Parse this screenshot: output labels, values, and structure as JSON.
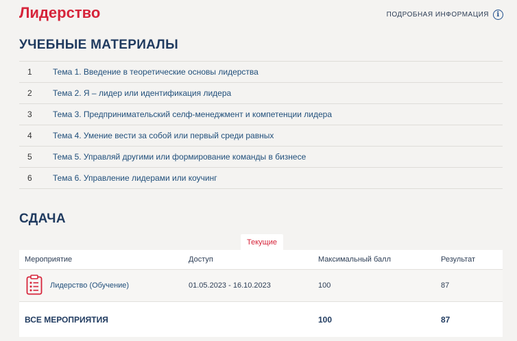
{
  "header": {
    "title": "Лидерство",
    "more_info_label": "ПОДРОБНАЯ ИНФОРМАЦИЯ"
  },
  "materials": {
    "title": "УЧЕБНЫЕ МАТЕРИАЛЫ",
    "items": [
      {
        "num": "1",
        "label": "Тема 1. Введение в теоретические основы лидерства"
      },
      {
        "num": "2",
        "label": "Тема 2. Я – лидер или идентификация лидера"
      },
      {
        "num": "3",
        "label": "Тема 3. Предпринимательский селф-менеджмент и компетенции лидера"
      },
      {
        "num": "4",
        "label": "Тема 4. Умение вести за собой или первый среди равных"
      },
      {
        "num": "5",
        "label": "Тема 5. Управляй другими или формирование команды в бизнесе"
      },
      {
        "num": "6",
        "label": "Тема 6. Управление лидерами или коучинг"
      }
    ]
  },
  "submission": {
    "title": "СДАЧА",
    "tab_label": "Текущие",
    "columns": [
      "Мероприятие",
      "Доступ",
      "Максимальный балл",
      "Результат"
    ],
    "rows": [
      {
        "event": "Лидерство (Обучение)",
        "access": "01.05.2023 - 16.10.2023",
        "max_score": "100",
        "result": "87"
      }
    ],
    "total": {
      "label": "ВСЕ МЕРОПРИЯТИЯ",
      "max_score": "100",
      "result": "87"
    }
  },
  "colors": {
    "accent": "#d6243a",
    "heading": "#1f3a5f",
    "link": "#1f4e7a",
    "background": "#f4f3f1"
  },
  "icons": {
    "info": "info-icon",
    "event": "clipboard-checklist-icon"
  }
}
